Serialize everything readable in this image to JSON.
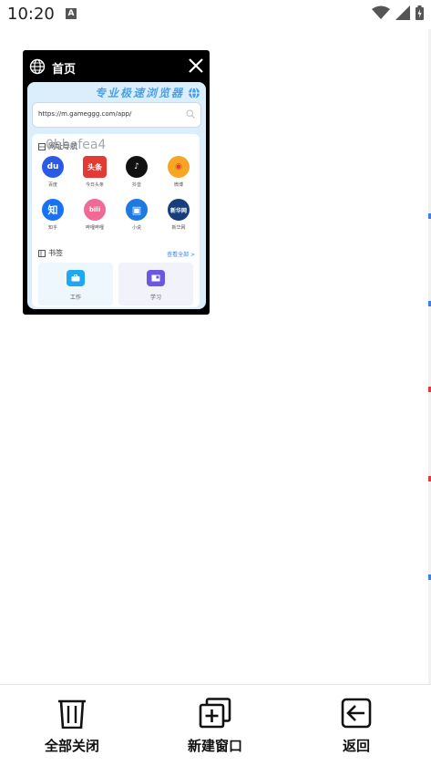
{
  "status_bar": {
    "time": "10:20",
    "notification_icon": "A"
  },
  "tab": {
    "title": "首页",
    "preview": {
      "banner": "专业极速浏览器",
      "url": "https://m.gameggg.com/app/",
      "watermark": "0bbefea4",
      "section_title": "网址导航",
      "apps": [
        {
          "label": "百度",
          "glyph": "du",
          "color": "#2a5be6"
        },
        {
          "label": "今日头条",
          "glyph": "头条",
          "color": "#e53935"
        },
        {
          "label": "抖音",
          "glyph": "♪",
          "color": "#111111"
        },
        {
          "label": "微博",
          "glyph": "◉",
          "color": "#f5a623"
        },
        {
          "label": "知乎",
          "glyph": "知",
          "color": "#1772f6"
        },
        {
          "label": "哔哩哔哩",
          "glyph": "bili",
          "color": "#f06a95"
        },
        {
          "label": "小说",
          "glyph": "▣",
          "color": "#1f7ae0"
        },
        {
          "label": "新华网",
          "glyph": "新华网",
          "color": "#163e7a"
        }
      ],
      "bookmarks_title": "书签",
      "see_all": "查看全部 >",
      "bookmarks": [
        {
          "label": "工作",
          "icon_color": "#1ea7f2",
          "bg": "#eef7fd"
        },
        {
          "label": "学习",
          "icon_color": "#6b57e0",
          "bg": "#f2f2fb"
        }
      ]
    }
  },
  "bottom_bar": {
    "close_all": "全部关闭",
    "new_window": "新建窗口",
    "back": "返回"
  }
}
